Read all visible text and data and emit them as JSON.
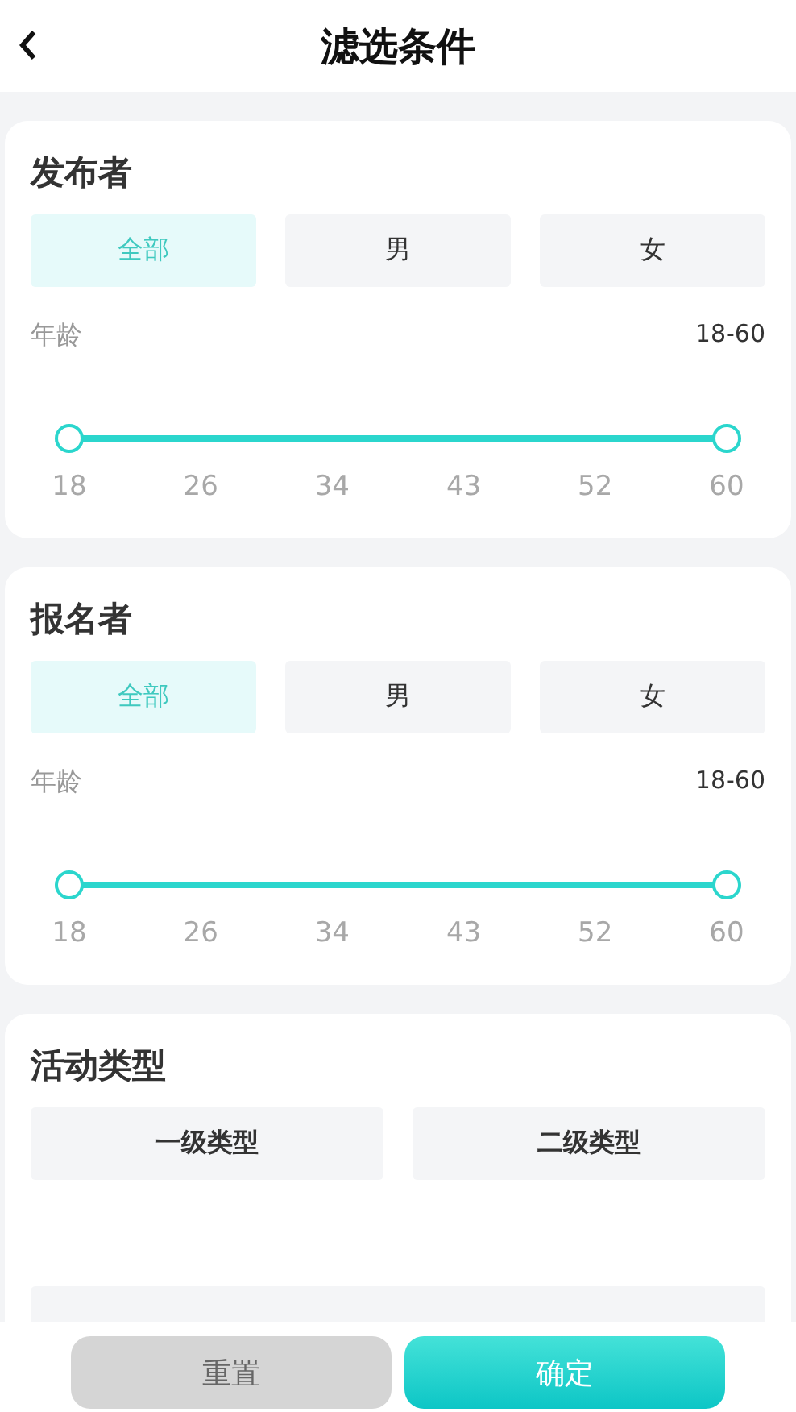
{
  "header": {
    "title": "滤选条件"
  },
  "sections": [
    {
      "kind": "gender_age",
      "title": "发布者",
      "options": [
        {
          "label": "全部",
          "selected": true
        },
        {
          "label": "男",
          "selected": false
        },
        {
          "label": "女",
          "selected": false
        }
      ],
      "age_label": "年龄",
      "age_value": "18-60",
      "thumbs": [
        {
          "level": 0
        },
        {
          "level": 1
        }
      ],
      "ticks": [
        "18",
        "26",
        "34",
        "43",
        "52",
        "60"
      ]
    },
    {
      "kind": "gender_age",
      "title": "报名者",
      "options": [
        {
          "label": "全部",
          "selected": true
        },
        {
          "label": "男",
          "selected": false
        },
        {
          "label": "女",
          "selected": false
        }
      ],
      "age_label": "年龄",
      "age_value": "18-60",
      "thumbs": [
        {
          "level": 0
        },
        {
          "level": 1
        }
      ],
      "ticks": [
        "18",
        "26",
        "34",
        "43",
        "52",
        "60"
      ]
    },
    {
      "kind": "type",
      "title": "活动类型",
      "options": [
        {
          "label": "一级类型",
          "selected": false
        },
        {
          "label": "二级类型",
          "selected": false
        }
      ]
    }
  ],
  "buttons": [
    {
      "label": "重置",
      "kind": "secondary"
    },
    {
      "label": "确定",
      "kind": "primary"
    }
  ]
}
